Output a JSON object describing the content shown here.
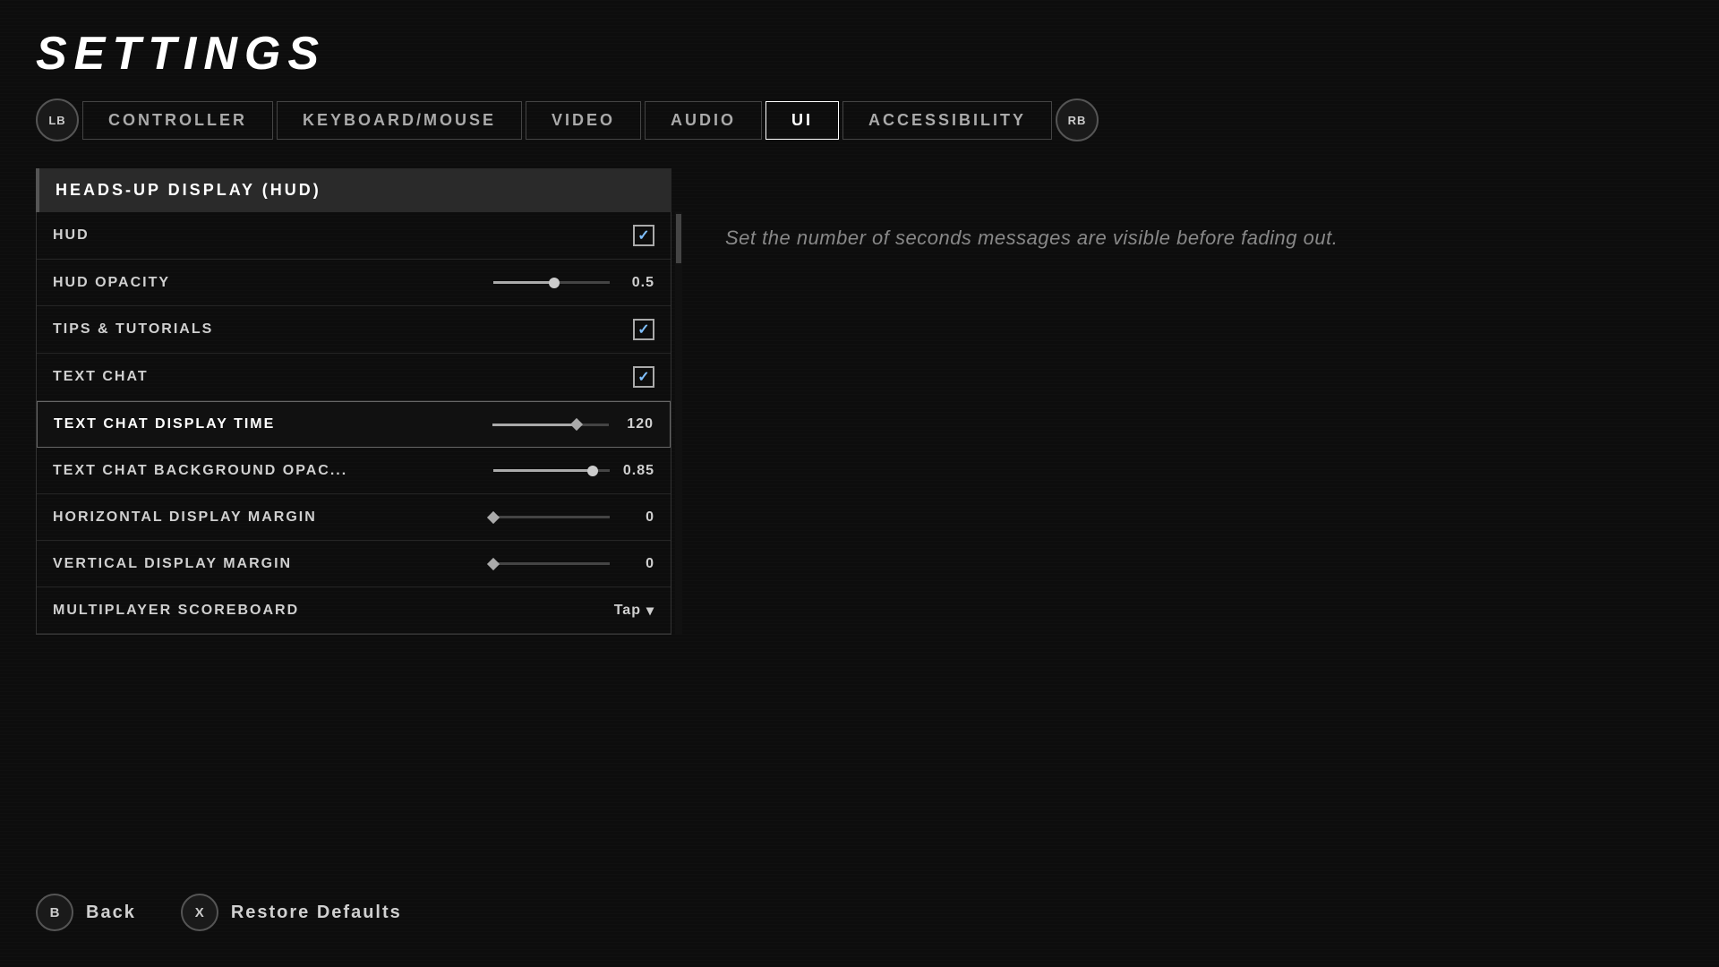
{
  "page": {
    "title": "SETTINGS"
  },
  "nav": {
    "lb": "LB",
    "rb": "RB"
  },
  "tabs": [
    {
      "id": "controller",
      "label": "CONTROLLER",
      "active": false
    },
    {
      "id": "keyboard-mouse",
      "label": "KEYBOARD/MOUSE",
      "active": false
    },
    {
      "id": "video",
      "label": "VIDEO",
      "active": false
    },
    {
      "id": "audio",
      "label": "AUDIO",
      "active": false
    },
    {
      "id": "ui",
      "label": "UI",
      "active": true
    },
    {
      "id": "accessibility",
      "label": "ACCESSIBILITY",
      "active": false
    }
  ],
  "section": {
    "header": "HEADS-UP DISPLAY (HUD)"
  },
  "settings": [
    {
      "id": "hud",
      "label": "HUD",
      "type": "checkbox",
      "checked": true,
      "selected": false
    },
    {
      "id": "hud-opacity",
      "label": "HUD OPACITY",
      "type": "slider",
      "value": "0.5",
      "fillPercent": 52,
      "selected": false
    },
    {
      "id": "tips-tutorials",
      "label": "TIPS & TUTORIALS",
      "type": "checkbox",
      "checked": true,
      "selected": false
    },
    {
      "id": "text-chat",
      "label": "TEXT CHAT",
      "type": "checkbox",
      "checked": true,
      "selected": false
    },
    {
      "id": "text-chat-display-time",
      "label": "TEXT CHAT DISPLAY TIME",
      "type": "slider",
      "value": "120",
      "fillPercent": 72,
      "selected": true
    },
    {
      "id": "text-chat-background-opacity",
      "label": "TEXT CHAT BACKGROUND OPACITY",
      "type": "slider",
      "value": "0.85",
      "fillPercent": 85,
      "selected": false
    },
    {
      "id": "horizontal-display-margin",
      "label": "HORIZONTAL DISPLAY MARGIN",
      "type": "slider",
      "value": "0",
      "fillPercent": 0,
      "selected": false
    },
    {
      "id": "vertical-display-margin",
      "label": "VERTICAL DISPLAY MARGIN",
      "type": "slider",
      "value": "0",
      "fillPercent": 0,
      "selected": false
    },
    {
      "id": "multiplayer-scoreboard",
      "label": "MULTIPLAYER SCOREBOARD",
      "type": "dropdown",
      "value": "Tap",
      "selected": false
    }
  ],
  "description": {
    "text": "Set the number of seconds messages are visible before fading out."
  },
  "bottomActions": [
    {
      "id": "back",
      "icon": "B",
      "label": "Back"
    },
    {
      "id": "restore-defaults",
      "icon": "X",
      "label": "Restore Defaults"
    }
  ]
}
